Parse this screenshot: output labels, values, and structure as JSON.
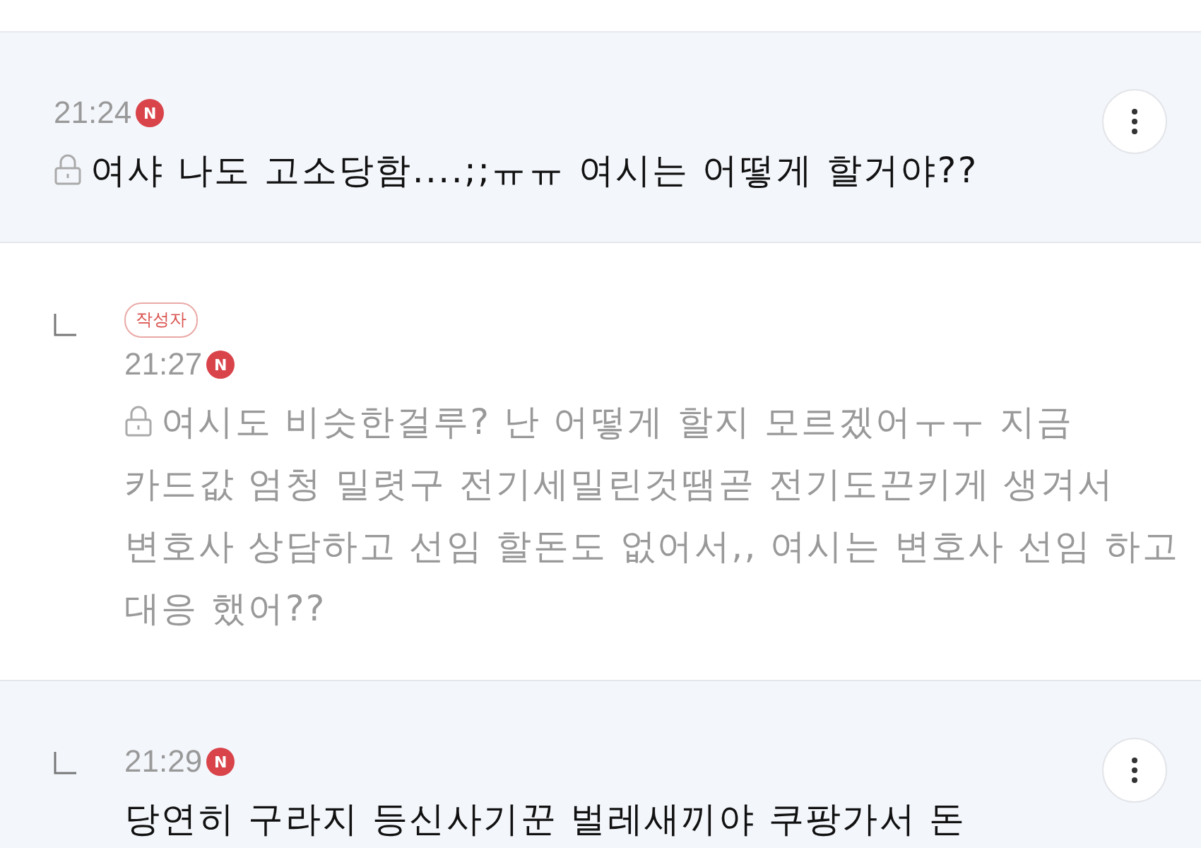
{
  "comments": [
    {
      "reply": false,
      "highlighted": true,
      "time": "21:24",
      "new_mark": "N",
      "locked": true,
      "muted": false,
      "menu": true,
      "text": "여샤 나도 고소당함....;;ㅠㅠ 여시는 어떻게 할거야??"
    },
    {
      "reply": true,
      "highlighted": false,
      "badge": "작성자",
      "time": "21:27",
      "new_mark": "N",
      "locked": true,
      "muted": true,
      "menu": false,
      "text": "여시도 비슷한걸루? 난 어떻게 할지 모르겠어ㅜㅜ 지금 카드값 엄청 밀렷구 전기세밀린것땜곧 전기도끈키게 생겨서 변호사 상담하고 선임 할돈도 없어서,, 여시는 변호사 선임 하고 대응 했어??"
    },
    {
      "reply": true,
      "highlighted": true,
      "time": "21:29",
      "new_mark": "N",
      "locked": false,
      "muted": false,
      "menu": true,
      "text": "당연히 구라지 등신사기꾼 벌레새끼야 쿠팡가서 돈"
    }
  ]
}
